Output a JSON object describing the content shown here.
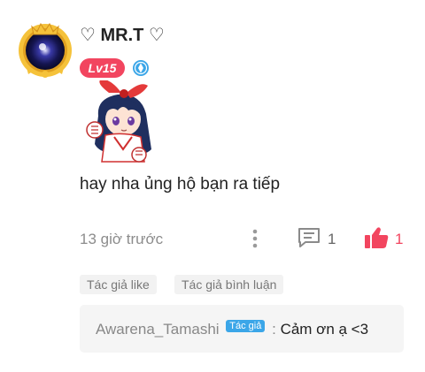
{
  "user": {
    "name": "♡ MR.T ♡",
    "level": "Lv15"
  },
  "comment": {
    "text": "hay nha ủng hộ bạn ra tiếp",
    "time": "13 giờ trước",
    "reply_count": "1",
    "like_count": "1"
  },
  "tags": [
    "Tác giả like",
    "Tác giả bình luận"
  ],
  "reply": {
    "user": "Awarena_Tamashi",
    "author_badge": "Tác giả",
    "separator": ":",
    "text": "Cảm ơn ạ <3"
  },
  "colors": {
    "accent_red": "#f2455f",
    "author_badge_blue": "#3ba6e8",
    "muted_gray": "#8c8c8c"
  },
  "icons": [
    "avatar-frame-icon",
    "verified-icon",
    "more-icon",
    "reply-icon",
    "thumbs-up-icon"
  ]
}
